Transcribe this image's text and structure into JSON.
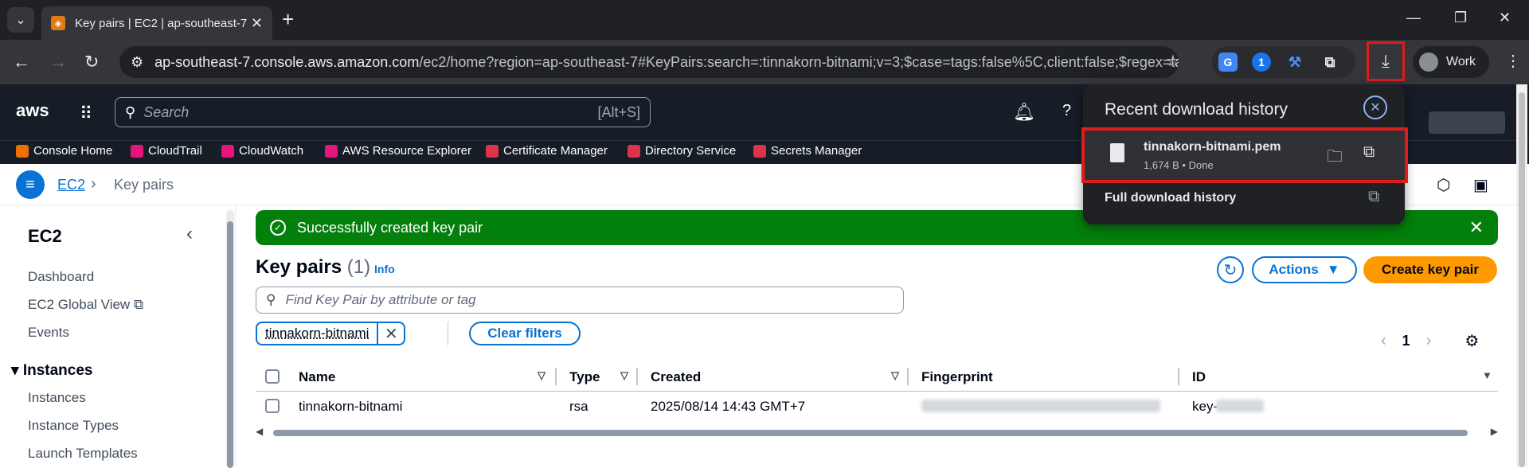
{
  "browser": {
    "tab_title": "Key pairs | EC2 | ap-southeast-7",
    "url_host": "ap-southeast-7.console.aws.amazon.com",
    "url_path": "/ec2/home?region=ap-southeast-7#KeyPairs:search=:tinnakorn-bitnami;v=3;$case=tags:false%5C,client:false;$regex=ta...",
    "profile_name": "Work"
  },
  "download_panel": {
    "title": "Recent download history",
    "file_name": "tinnakorn-bitnami.pem",
    "file_meta": "1,674 B • Done",
    "full_history": "Full download history"
  },
  "aws_header": {
    "logo": "aws",
    "search_placeholder": "Search",
    "search_shortcut": "[Alt+S]"
  },
  "favorites": [
    {
      "label": "Console Home",
      "color": "#ed7100"
    },
    {
      "label": "CloudTrail",
      "color": "#e7157b"
    },
    {
      "label": "CloudWatch",
      "color": "#e7157b"
    },
    {
      "label": "AWS Resource Explorer",
      "color": "#e7157b"
    },
    {
      "label": "Certificate Manager",
      "color": "#dd344c"
    },
    {
      "label": "Directory Service",
      "color": "#dd344c"
    },
    {
      "label": "Secrets Manager",
      "color": "#dd344c"
    }
  ],
  "breadcrumb": {
    "root": "EC2",
    "current": "Key pairs"
  },
  "sidebar": {
    "title": "EC2",
    "links": [
      "Dashboard",
      "EC2 Global View",
      "Events"
    ],
    "section": "Instances",
    "section_links": [
      "Instances",
      "Instance Types",
      "Launch Templates"
    ]
  },
  "flash": {
    "message": "Successfully created key pair"
  },
  "key_pairs": {
    "title": "Key pairs",
    "count": "(1)",
    "info": "Info",
    "actions_label": "Actions",
    "create_label": "Create key pair",
    "filter_placeholder": "Find Key Pair by attribute or tag",
    "filter_token": "tinnakorn-bitnami",
    "clear_filters": "Clear filters",
    "page": "1",
    "columns": [
      "Name",
      "Type",
      "Created",
      "Fingerprint",
      "ID"
    ],
    "rows": [
      {
        "name": "tinnakorn-bitnami",
        "type": "rsa",
        "created": "2025/08/14 14:43 GMT+7",
        "id": "key-"
      }
    ]
  },
  "colors": {
    "aws_nav": "#161d26",
    "accent": "#0972d3",
    "success": "#037f0c",
    "primary_button": "#ff9900",
    "highlight_border": "#e01b1b"
  }
}
